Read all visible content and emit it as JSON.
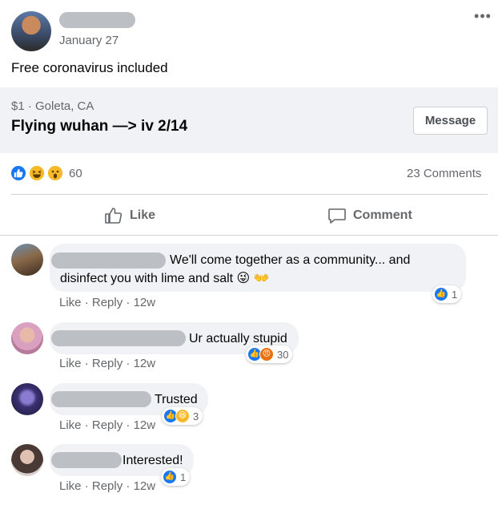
{
  "post": {
    "date": "January 27",
    "text": "Free coronavirus included",
    "more_icon": "more-horizontal-icon"
  },
  "listing": {
    "meta": "$1 · Goleta, CA",
    "title": "Flying wuhan —> iv 2/14",
    "message_label": "Message"
  },
  "reactions": {
    "icons": [
      "like-icon",
      "haha-icon",
      "wow-icon"
    ],
    "count": "60",
    "comments": "23 Comments"
  },
  "actions": {
    "like_label": "Like",
    "comment_label": "Comment"
  },
  "comments": [
    {
      "line1": "We'll come together as a community... and",
      "line2": "disinfect you with lime and salt 😜 👐",
      "like": "Like",
      "reply": "Reply",
      "time": "12w",
      "reaction_icons": [
        "like-icon"
      ],
      "reaction_count": "1"
    },
    {
      "line1": "Ur actually stupid",
      "like": "Like",
      "reply": "Reply",
      "time": "12w",
      "reaction_icons": [
        "like-icon",
        "angry-icon"
      ],
      "reaction_count": "30"
    },
    {
      "line1": "Trusted",
      "like": "Like",
      "reply": "Reply",
      "time": "12w",
      "reaction_icons": [
        "like-icon",
        "haha-icon"
      ],
      "reaction_count": "3"
    },
    {
      "line1": "Interested!",
      "like": "Like",
      "reply": "Reply",
      "time": "12w",
      "reaction_icons": [
        "like-icon"
      ],
      "reaction_count": "1"
    }
  ],
  "colors": {
    "accent": "#1877f2",
    "secondary_text": "#65676b",
    "bubble": "#f0f2f5",
    "reaction_yellow": "#f7b928",
    "reaction_angry": "#e9710f"
  }
}
